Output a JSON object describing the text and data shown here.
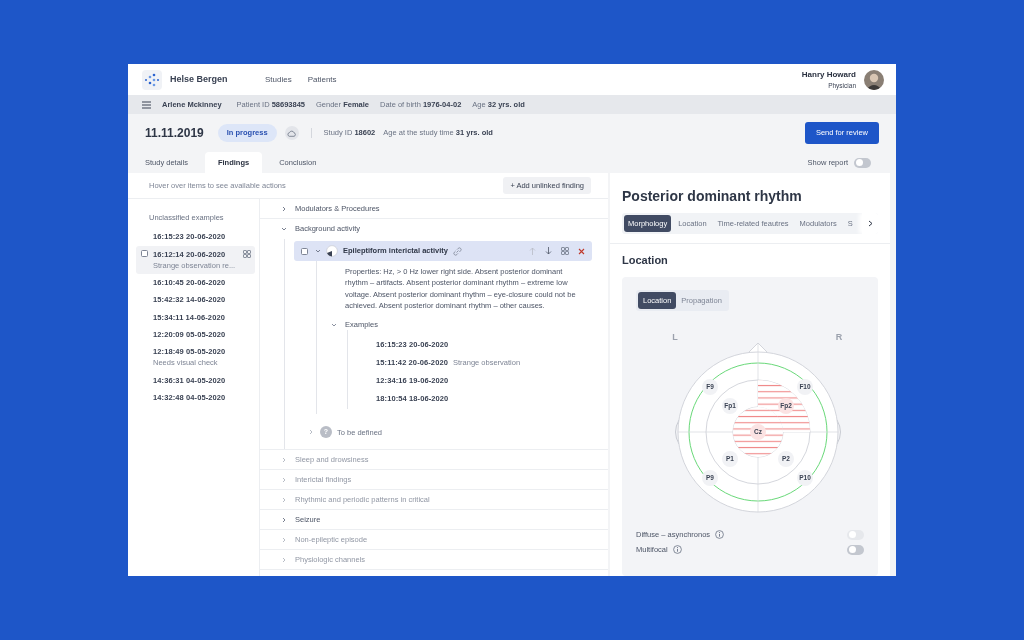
{
  "app": {
    "name": "Helse Bergen"
  },
  "nav": [
    {
      "label": "Studies",
      "selected": false
    },
    {
      "label": "Patients",
      "selected": false
    }
  ],
  "user": {
    "name": "Hanry Howard",
    "role": "Physician"
  },
  "patient": {
    "name": "Arlene Mckinney",
    "fields": [
      {
        "label": "Patient ID",
        "value": "58693845"
      },
      {
        "label": "Gender",
        "value": "Female"
      },
      {
        "label": "Date of birth",
        "value": "1976-04-02"
      },
      {
        "label": "Age",
        "value": "32 yrs. old"
      }
    ]
  },
  "study": {
    "date": "11.11.2019",
    "status": "In progress",
    "fields": [
      {
        "label": "Study ID",
        "value": "18602"
      },
      {
        "label": "Age at the study time",
        "value": "31 yrs. old"
      }
    ],
    "action": "Send for review"
  },
  "tabs": [
    {
      "label": "Study details",
      "selected": false
    },
    {
      "label": "Findings",
      "selected": true
    },
    {
      "label": "Conclusion",
      "selected": false
    }
  ],
  "show_report": {
    "label": "Show report",
    "on": false
  },
  "hint": "Hover over items to see available actions",
  "add_button": "+ Add unlinked finding",
  "examples": {
    "title": "Unclassified examples",
    "items": [
      {
        "time": "16:15:23 20-06-2020",
        "selected": false
      },
      {
        "time": "16:12:14 20-06-2020",
        "note": "Strange observation re...",
        "selected": true
      },
      {
        "time": "16:10:45 20-06-2020",
        "selected": false
      },
      {
        "time": "15:42:32 14-06-2020",
        "selected": false
      },
      {
        "time": "15:34:11 14-06-2020",
        "selected": false
      },
      {
        "time": "12:20:09 05-05-2020",
        "selected": false
      },
      {
        "time": "12:18:49 05-05-2020",
        "note": "Needs visual check",
        "selected": false
      },
      {
        "time": "14:36:31 04-05-2020",
        "selected": false
      },
      {
        "time": "14:32:48 04-05-2020",
        "selected": false
      }
    ]
  },
  "tree": [
    {
      "label": "Modulators & Procedures",
      "expanded": false,
      "muted": false
    },
    {
      "label": "Background activity",
      "expanded": true,
      "muted": false,
      "children": [
        {
          "kind": "finding",
          "label": "Epileptiform interictal activity",
          "selected": true,
          "expanded": true,
          "checked": false,
          "properties": "Properties: Hz, > 0 Hz lower right side. Absent posterior dominant rhythm – artifacts. Absent posterior dominant rhythm – extreme low voltage. Absent posterior dominant rhythm – eye-closure could not be achieved. Absent posterior dominant rhythm – other causes.",
          "examples": {
            "label": "Examples",
            "expanded": true,
            "items": [
              {
                "time": "16:15:23 20-06-2020"
              },
              {
                "time": "15:11:42 20-06-2020",
                "note": "Strange observation"
              },
              {
                "time": "12:34:16 19-06-2020"
              },
              {
                "time": "18:10:54 18-06-2020"
              }
            ]
          }
        },
        {
          "kind": "undefined",
          "label": "To be defined",
          "symbol": "?",
          "selected": false,
          "expanded": false
        }
      ]
    },
    {
      "label": "Sleep and drowsiness",
      "expanded": false,
      "muted": true
    },
    {
      "label": "Interictal findings",
      "expanded": false,
      "muted": true
    },
    {
      "label": "Rhythmic and periodic patterns in critical",
      "expanded": false,
      "muted": true
    },
    {
      "label": "Seizure",
      "expanded": false,
      "muted": false
    },
    {
      "label": "Non-epileptic episode",
      "expanded": false,
      "muted": true
    },
    {
      "label": "Physiologic channels",
      "expanded": false,
      "muted": true
    }
  ],
  "detail": {
    "title": "Posterior dominant rhythm",
    "tabs": [
      {
        "label": "Morphology",
        "selected": true
      },
      {
        "label": "Location",
        "selected": false
      },
      {
        "label": "Time-related feautres",
        "selected": false
      },
      {
        "label": "Modulators",
        "selected": false
      },
      {
        "label": "S",
        "selected": false
      }
    ],
    "section": "Location",
    "views": [
      {
        "label": "Location",
        "selected": true
      },
      {
        "label": "Propagation",
        "selected": false
      }
    ],
    "sides": [
      "L",
      "R"
    ],
    "electrodes": [
      {
        "label": "F9",
        "selected": false
      },
      {
        "label": "F10",
        "selected": false
      },
      {
        "label": "Fp1",
        "selected": false
      },
      {
        "label": "Fp2",
        "selected": true
      },
      {
        "label": "Cz",
        "selected": true
      },
      {
        "label": "P1",
        "selected": false
      },
      {
        "label": "P2",
        "selected": false
      },
      {
        "label": "P9",
        "selected": false
      },
      {
        "label": "P10",
        "selected": false
      }
    ],
    "options": [
      {
        "label": "Diffuse – asynchronos",
        "on": false,
        "disabled": true
      },
      {
        "label": "Multifocal",
        "on": false,
        "disabled": false
      }
    ]
  }
}
